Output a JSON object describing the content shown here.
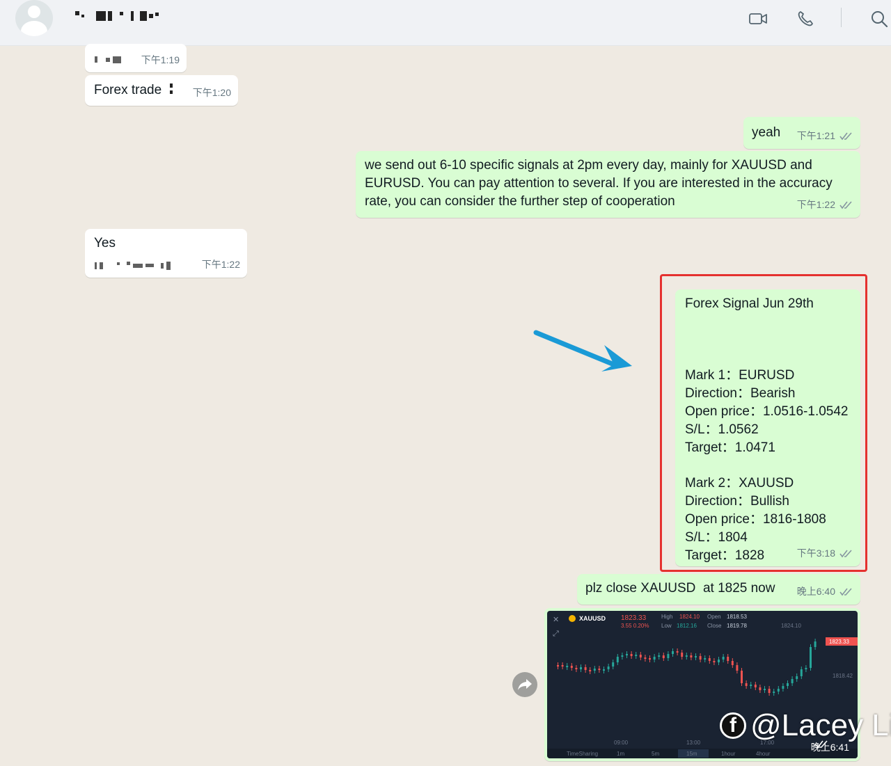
{
  "header": {
    "contact_name": "",
    "icons": [
      "video-call-icon",
      "voice-call-icon",
      "search-icon"
    ]
  },
  "messages": [
    {
      "id": "m1",
      "dir": "in",
      "text": "",
      "time": "下午1:19"
    },
    {
      "id": "m2",
      "dir": "in",
      "text": "Forex trade",
      "time": "下午1:20"
    },
    {
      "id": "m3",
      "dir": "out",
      "text": "yeah",
      "time": "下午1:21"
    },
    {
      "id": "m4",
      "dir": "out",
      "text": "we send out 6-10 specific signals at 2pm every day, mainly for XAUUSD and EURUSD. You can pay attention to several. If you are interested in the accuracy rate, you can consider the further step of cooperation",
      "time": "下午1:22"
    },
    {
      "id": "m5",
      "dir": "in",
      "text": "Yes",
      "time": "下午1:22"
    },
    {
      "id": "m6",
      "dir": "out",
      "time": "下午3:18",
      "title": "Forex Signal  Jun 29th",
      "marks": [
        {
          "label": "Mark 1：EURUSD",
          "direction": "Direction：Bearish",
          "open": "Open price：1.0516-1.0542",
          "sl": "S/L：1.0562",
          "target": "Target：1.0471"
        },
        {
          "label": "Mark 2：XAUUSD",
          "direction": "Direction：Bullish",
          "open": "Open price：1816-1808",
          "sl": "S/L：1804",
          "target": "Target：1828"
        }
      ]
    },
    {
      "id": "m7",
      "dir": "out",
      "text": "plz close XAUUSD  at 1825 now",
      "time": "晚上6:40"
    },
    {
      "id": "m8",
      "dir": "out",
      "type": "image",
      "time": "晚上6:41"
    }
  ],
  "chart_image": {
    "symbol": "XAUUSD",
    "price": "1823.33",
    "change": "3.55",
    "change_pct": "0.20%",
    "high_label": "High",
    "high": "1824.10",
    "low_label": "Low",
    "low": "1812.16",
    "open_label": "Open",
    "open": "1818.53",
    "close_label": "Close",
    "close": "1819.78",
    "price_axis": [
      "1824.10",
      "1823.33",
      "1818.42"
    ],
    "time_axis": [
      "09:00",
      "13:00",
      "17:00"
    ],
    "timeframes": [
      "TimeSharing",
      "1m",
      "5m",
      "15m",
      "1hour",
      "4hour"
    ],
    "colors": {
      "up": "#26a69a",
      "down": "#ef5350",
      "bg": "#1a2332"
    }
  },
  "watermark": "@Lacey Li",
  "colors": {
    "incoming": "#ffffff",
    "outgoing": "#d9fdd3",
    "highlight_frame": "#e5312f",
    "arrow": "#1a9ad6",
    "chat_bg": "#efeae2"
  }
}
